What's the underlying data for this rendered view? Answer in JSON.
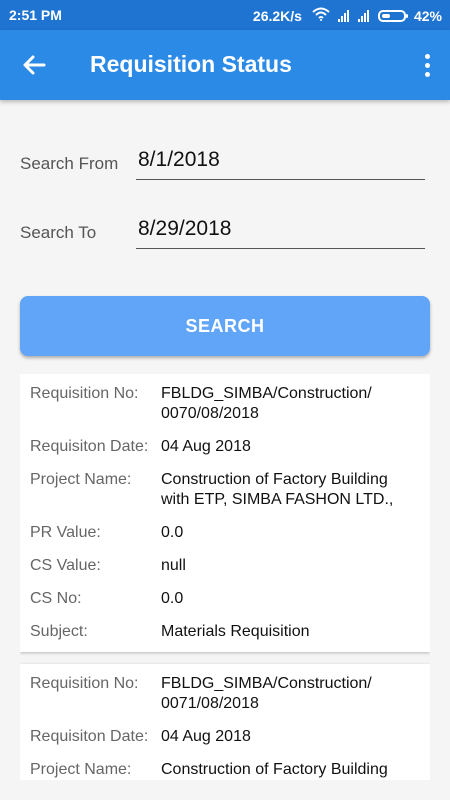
{
  "status_bar": {
    "time": "2:51 PM",
    "speed": "26.2K/s",
    "battery": "42%",
    "battery_level": 0.42
  },
  "app_bar": {
    "title": "Requisition Status",
    "back_icon": "arrow-left-icon",
    "menu_icon": "more-vert-icon"
  },
  "form": {
    "from_label": "Search From",
    "from_value": "8/1/2018",
    "to_label": "Search To",
    "to_value": "8/29/2018",
    "search_label": "SEARCH"
  },
  "cards": [
    {
      "requisition_no_label": "Requisition No:",
      "requisition_no": "FBLDG_SIMBA/Construction/\n0070/08/2018",
      "date_label": "Requisiton Date:",
      "date": "04 Aug 2018",
      "project_label": "Project Name:",
      "project": "Construction of Factory Building with ETP, SIMBA FASHON LTD.,",
      "pr_label": "PR Value:",
      "pr": "0.0",
      "cs_value_label": "CS Value:",
      "cs_value": "null",
      "cs_no_label": "CS No:",
      "cs_no": "0.0",
      "subject_label": "Subject:",
      "subject": "Materials Requisition"
    },
    {
      "requisition_no_label": "Requisition No:",
      "requisition_no": "FBLDG_SIMBA/Construction/\n0071/08/2018",
      "date_label": "Requisiton Date:",
      "date": "04 Aug 2018",
      "project_label": "Project Name:",
      "project": "Construction of Factory Building with ETP, SIMBA FASHON LTD.,"
    }
  ]
}
